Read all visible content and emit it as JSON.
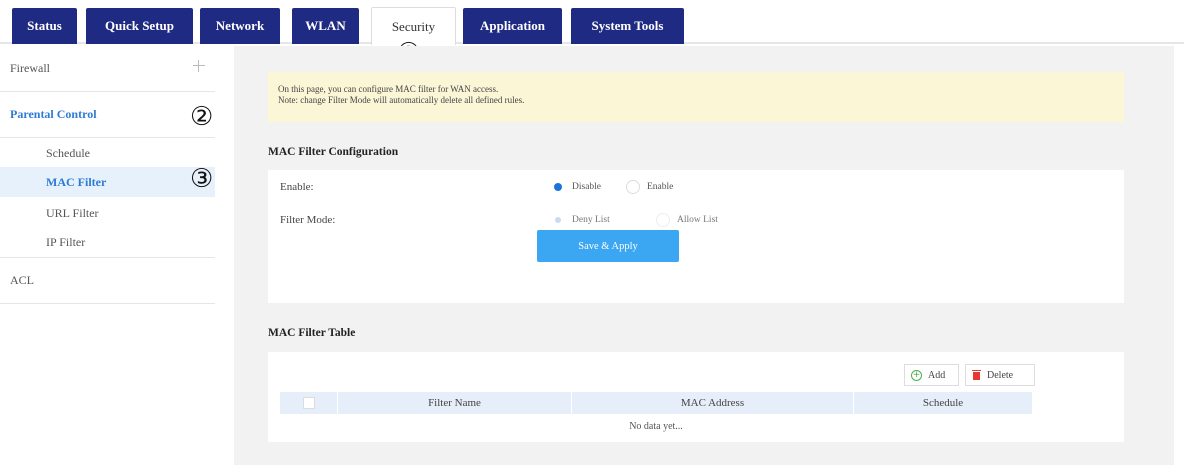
{
  "nav": {
    "tabs": [
      {
        "label": "Status"
      },
      {
        "label": "Quick Setup"
      },
      {
        "label": "Network"
      },
      {
        "label": "WLAN"
      },
      {
        "label": "Security"
      },
      {
        "label": "Application"
      },
      {
        "label": "System Tools"
      }
    ],
    "active_tab": "Security",
    "tab_color": "#1f2b82"
  },
  "annotations": [
    "①",
    "②",
    "③"
  ],
  "sidebar": {
    "items": [
      {
        "label": "Firewall"
      },
      {
        "label": "Parental Control"
      },
      {
        "label": "Schedule"
      },
      {
        "label": "MAC Filter"
      },
      {
        "label": "URL Filter"
      },
      {
        "label": "IP Filter"
      },
      {
        "label": "ACL"
      }
    ],
    "active_item": "MAC Filter",
    "accent": "#2f7bd3"
  },
  "notice": {
    "line1": "On this page, you can configure MAC filter for WAN access.",
    "line2": "Note: change Filter Mode will automatically delete all defined rules."
  },
  "config": {
    "title": "MAC Filter Configuration",
    "enable_label": "Enable:",
    "enable_options": [
      "Disable",
      "Enable"
    ],
    "enable_selected": "Disable",
    "mode_label": "Filter Mode:",
    "mode_options": [
      "Deny List",
      "Allow List"
    ],
    "mode_selected": "Deny List",
    "apply_label": "Save & Apply",
    "apply_color": "#3ba6f2"
  },
  "table": {
    "title": "MAC Filter Table",
    "add_label": "Add",
    "delete_label": "Delete",
    "columns": [
      "Filter Name",
      "MAC Address",
      "Schedule"
    ],
    "empty_text": "No data yet..."
  }
}
